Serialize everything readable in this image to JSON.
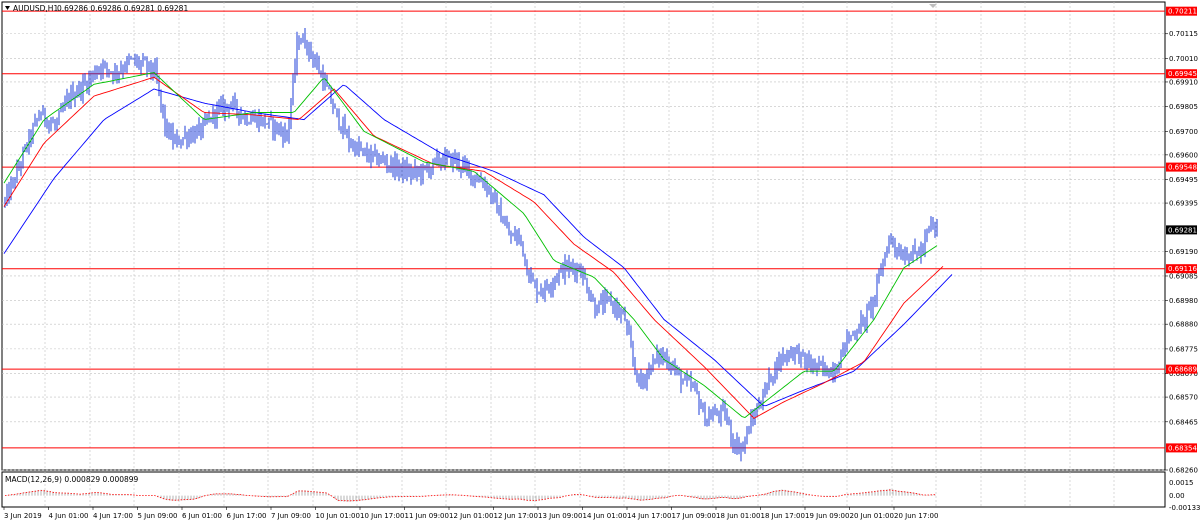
{
  "header": {
    "symbol": "AUDUSD,H1",
    "ohlc": "0.69286 0.69286 0.69281 0.69281"
  },
  "macd_header": "MACD(12,26,9) 0.000829 0.000899",
  "colors": {
    "background": "#ffffff",
    "grid": "#c0c0c0",
    "candle": "#1f3fd8",
    "level": "#ff0000",
    "ma_fast": "#00c000",
    "ma_mid": "#ff0000",
    "ma_slow": "#0000ff",
    "macd_hist": "#a0a0a0",
    "macd_signal": "#ff0000"
  },
  "chart_data": [
    {
      "type": "candlestick",
      "symbol": "AUDUSD",
      "timeframe": "H1",
      "price_axis": {
        "min": 0.6826,
        "max": 0.7025,
        "ticks": [
          "0.70115",
          "0.70010",
          "0.69910",
          "0.69805",
          "0.69700",
          "0.69600",
          "0.69495",
          "0.69395",
          "0.69190",
          "0.69085",
          "0.68980",
          "0.68880",
          "0.68775",
          "0.68670",
          "0.68570",
          "0.68465",
          "0.68260"
        ]
      },
      "levels": [
        {
          "value": 0.70211,
          "label": "0.70211"
        },
        {
          "value": 0.69945,
          "label": "0.69945"
        },
        {
          "value": 0.69548,
          "label": "0.69548"
        },
        {
          "value": 0.69116,
          "label": "0.69116"
        },
        {
          "value": 0.68689,
          "label": "0.68689"
        },
        {
          "value": 0.68354,
          "label": "0.68354"
        }
      ],
      "current_price": {
        "value": 0.69281,
        "label": "0.69281"
      },
      "time_axis": [
        "3 Jun 2019",
        "4 Jun 01:00",
        "4 Jun 17:00",
        "5 Jun 09:00",
        "6 Jun 01:00",
        "6 Jun 17:00",
        "7 Jun 09:00",
        "10 Jun 01:00",
        "10 Jun 17:00",
        "11 Jun 09:00",
        "12 Jun 01:00",
        "12 Jun 17:00",
        "13 Jun 09:00",
        "14 Jun 01:00",
        "14 Jun 17:00",
        "17 Jun 09:00",
        "18 Jun 01:00",
        "18 Jun 17:00",
        "19 Jun 09:00",
        "20 Jun 01:00",
        "20 Jun 17:00"
      ],
      "price_path": [
        [
          0,
          0.694
        ],
        [
          10,
          0.695
        ],
        [
          20,
          0.6962
        ],
        [
          35,
          0.6978
        ],
        [
          50,
          0.6972
        ],
        [
          65,
          0.6985
        ],
        [
          80,
          0.699
        ],
        [
          95,
          0.6998
        ],
        [
          110,
          0.6995
        ],
        [
          125,
          0.7
        ],
        [
          140,
          0.6998
        ],
        [
          150,
          0.6995
        ],
        [
          160,
          0.6972
        ],
        [
          170,
          0.6965
        ],
        [
          180,
          0.6968
        ],
        [
          195,
          0.697
        ],
        [
          210,
          0.6978
        ],
        [
          225,
          0.6982
        ],
        [
          240,
          0.6976
        ],
        [
          255,
          0.6975
        ],
        [
          270,
          0.6972
        ],
        [
          282,
          0.6968
        ],
        [
          288,
          0.699
        ],
        [
          293,
          0.701
        ],
        [
          300,
          0.7008
        ],
        [
          310,
          0.7
        ],
        [
          320,
          0.699
        ],
        [
          330,
          0.6978
        ],
        [
          345,
          0.6965
        ],
        [
          360,
          0.696
        ],
        [
          375,
          0.6958
        ],
        [
          390,
          0.6955
        ],
        [
          405,
          0.6952
        ],
        [
          420,
          0.6953
        ],
        [
          435,
          0.6958
        ],
        [
          450,
          0.6958
        ],
        [
          465,
          0.6952
        ],
        [
          480,
          0.6948
        ],
        [
          495,
          0.6935
        ],
        [
          505,
          0.6925
        ],
        [
          515,
          0.6925
        ],
        [
          522,
          0.6912
        ],
        [
          530,
          0.6903
        ],
        [
          540,
          0.6903
        ],
        [
          550,
          0.6908
        ],
        [
          560,
          0.6912
        ],
        [
          575,
          0.6912
        ],
        [
          590,
          0.6895
        ],
        [
          605,
          0.6898
        ],
        [
          620,
          0.689
        ],
        [
          628,
          0.6872
        ],
        [
          635,
          0.6862
        ],
        [
          645,
          0.687
        ],
        [
          655,
          0.6875
        ],
        [
          665,
          0.6872
        ],
        [
          675,
          0.6865
        ],
        [
          690,
          0.686
        ],
        [
          700,
          0.6848
        ],
        [
          712,
          0.685
        ],
        [
          720,
          0.685
        ],
        [
          728,
          0.6838
        ],
        [
          737,
          0.6835
        ],
        [
          745,
          0.6845
        ],
        [
          752,
          0.6852
        ],
        [
          760,
          0.686
        ],
        [
          770,
          0.687
        ],
        [
          780,
          0.6875
        ],
        [
          790,
          0.6877
        ],
        [
          800,
          0.6872
        ],
        [
          810,
          0.687
        ],
        [
          822,
          0.6868
        ],
        [
          832,
          0.687
        ],
        [
          840,
          0.688
        ],
        [
          850,
          0.6885
        ],
        [
          860,
          0.689
        ],
        [
          870,
          0.69
        ],
        [
          878,
          0.6915
        ],
        [
          885,
          0.6925
        ],
        [
          895,
          0.6918
        ],
        [
          905,
          0.6918
        ],
        [
          912,
          0.6918
        ],
        [
          918,
          0.692
        ],
        [
          925,
          0.693
        ],
        [
          932,
          0.6928
        ]
      ],
      "ma_fast": [
        [
          0,
          0.6948
        ],
        [
          40,
          0.6975
        ],
        [
          90,
          0.699
        ],
        [
          150,
          0.6995
        ],
        [
          200,
          0.6975
        ],
        [
          250,
          0.6978
        ],
        [
          290,
          0.6978
        ],
        [
          320,
          0.6993
        ],
        [
          360,
          0.697
        ],
        [
          420,
          0.6957
        ],
        [
          470,
          0.6953
        ],
        [
          520,
          0.6935
        ],
        [
          550,
          0.6915
        ],
        [
          590,
          0.6908
        ],
        [
          630,
          0.689
        ],
        [
          660,
          0.6873
        ],
        [
          700,
          0.6862
        ],
        [
          740,
          0.6848
        ],
        [
          770,
          0.6858
        ],
        [
          800,
          0.6868
        ],
        [
          830,
          0.6868
        ],
        [
          870,
          0.689
        ],
        [
          900,
          0.6912
        ],
        [
          935,
          0.6922
        ]
      ],
      "ma_mid": [
        [
          0,
          0.6938
        ],
        [
          40,
          0.6965
        ],
        [
          90,
          0.6985
        ],
        [
          150,
          0.6993
        ],
        [
          200,
          0.6978
        ],
        [
          250,
          0.6977
        ],
        [
          295,
          0.6975
        ],
        [
          330,
          0.6988
        ],
        [
          370,
          0.6968
        ],
        [
          430,
          0.6956
        ],
        [
          480,
          0.6953
        ],
        [
          530,
          0.694
        ],
        [
          570,
          0.6922
        ],
        [
          610,
          0.691
        ],
        [
          650,
          0.689
        ],
        [
          700,
          0.687
        ],
        [
          750,
          0.6848
        ],
        [
          780,
          0.6855
        ],
        [
          820,
          0.6863
        ],
        [
          860,
          0.6872
        ],
        [
          900,
          0.6897
        ],
        [
          940,
          0.6913
        ]
      ],
      "ma_slow": [
        [
          0,
          0.6918
        ],
        [
          50,
          0.695
        ],
        [
          100,
          0.6975
        ],
        [
          150,
          0.6988
        ],
        [
          200,
          0.6982
        ],
        [
          250,
          0.6978
        ],
        [
          300,
          0.6975
        ],
        [
          340,
          0.699
        ],
        [
          380,
          0.6975
        ],
        [
          440,
          0.696
        ],
        [
          490,
          0.6953
        ],
        [
          540,
          0.6943
        ],
        [
          580,
          0.6925
        ],
        [
          620,
          0.6912
        ],
        [
          660,
          0.689
        ],
        [
          710,
          0.6873
        ],
        [
          760,
          0.6853
        ],
        [
          800,
          0.686
        ],
        [
          850,
          0.6868
        ],
        [
          900,
          0.6888
        ],
        [
          950,
          0.691
        ]
      ],
      "grid": true
    },
    {
      "type": "bar",
      "name": "MACD(12,26,9)",
      "value_axis": {
        "min": -0.0013,
        "max": 0.0027,
        "ticks": [
          "0.0015",
          "0.00",
          "-0.001331"
        ]
      }
    }
  ]
}
